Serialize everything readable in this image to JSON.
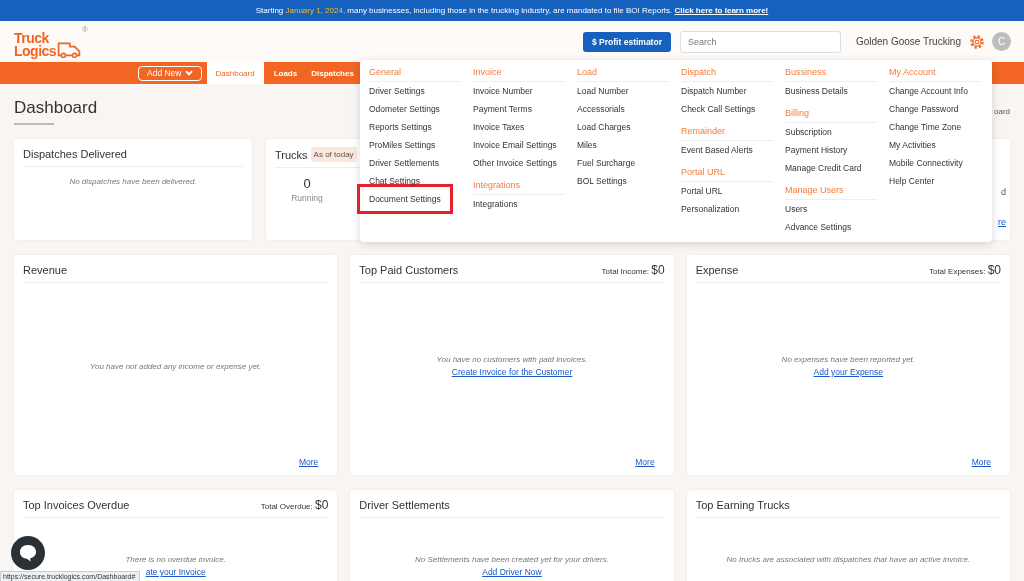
{
  "banner": {
    "lead": "Starting",
    "date": "January 1, 2024,",
    "rest": "many businesses, including those in the trucking industry, are mandated to file BOI Reports.",
    "link": "Click here to learn more!"
  },
  "header": {
    "logo": {
      "wordmark": "Truck Logics",
      "registered": "®"
    },
    "profit_button": "$ Profit estimator",
    "search": {
      "placeholder": "Search"
    },
    "company": "Golden Goose Trucking",
    "avatar": "C"
  },
  "nav": {
    "add_new": "Add New",
    "tabs": [
      {
        "label": "Dashboard",
        "selected": true
      },
      {
        "label": "Loads",
        "selected": false
      },
      {
        "label": "Dispatches",
        "selected": false
      }
    ]
  },
  "page": {
    "title": "Dashboard",
    "breadcrumb": "oard"
  },
  "card_rows": [
    {
      "cards": [
        {
          "kind": "message",
          "title": "Dispatches Delivered",
          "message": "No dispatches have been delivered."
        },
        {
          "kind": "stats",
          "title": "Trucks",
          "badge": "As of today",
          "stats": [
            {
              "value": "0",
              "label": "Running"
            }
          ]
        },
        {
          "kind": "covered",
          "text": "d",
          "link": "re"
        }
      ]
    },
    {
      "cards": [
        {
          "kind": "panel",
          "title": "Revenue",
          "message": "You have not added any income or expense yet.",
          "more": "More"
        },
        {
          "kind": "panel",
          "title": "Top Paid Customers",
          "total_label": "Total Income:",
          "total_value": "$0",
          "message": "You have no customers with paid invoices.",
          "link": "Create Invoice for the Customer",
          "more": "More"
        },
        {
          "kind": "panel",
          "title": "Expense",
          "total_label": "Total Expenses:",
          "total_value": "$0",
          "message": "No expenses have been reported yet.",
          "link": "Add your Expense",
          "more": "More"
        }
      ]
    },
    {
      "cards": [
        {
          "kind": "panel",
          "title": "Top Invoices Overdue",
          "total_label": "Total Overdue:",
          "total_value": "$0",
          "message": "There is no overdue invoice.",
          "link": "ate your Invoice"
        },
        {
          "kind": "panel",
          "title": "Driver Settlements",
          "message": "No Settlements have been created yet for your drivers.",
          "link": "Add Driver Now"
        },
        {
          "kind": "panel",
          "title": "Top Earning Trucks",
          "message": "No trucks are associated with dispatches that have an active invoice."
        }
      ]
    }
  ],
  "menu": {
    "columns": [
      {
        "sections": [
          {
            "heading": "General",
            "items": [
              {
                "label": "Driver Settings",
                "highlighted": false
              },
              {
                "label": "Odometer Settings",
                "highlighted": false
              },
              {
                "label": "Reports Settings",
                "highlighted": false
              },
              {
                "label": "ProMiles Settings",
                "highlighted": false
              },
              {
                "label": "Driver Settlements",
                "highlighted": false
              },
              {
                "label": "Chat Settings",
                "highlighted": false
              },
              {
                "label": "Document Settings",
                "highlighted": true
              }
            ]
          }
        ]
      },
      {
        "sections": [
          {
            "heading": "Invoice",
            "items": [
              {
                "label": "Invoice Number",
                "highlighted": false
              },
              {
                "label": "Payment Terms",
                "highlighted": false
              },
              {
                "label": "Invoice Taxes",
                "highlighted": false
              },
              {
                "label": "Invoice Email Settings",
                "highlighted": false
              },
              {
                "label": "Other Invoice Settings",
                "highlighted": false
              }
            ]
          },
          {
            "heading": "Integrations",
            "items": [
              {
                "label": "Integrations",
                "highlighted": false
              }
            ]
          }
        ]
      },
      {
        "sections": [
          {
            "heading": "Load",
            "items": [
              {
                "label": "Load Number",
                "highlighted": false
              },
              {
                "label": "Accessorials",
                "highlighted": false
              },
              {
                "label": "Load Charges",
                "highlighted": false
              },
              {
                "label": "Miles",
                "highlighted": false
              },
              {
                "label": "Fuel Surcharge",
                "highlighted": false
              },
              {
                "label": "BOL Settings",
                "highlighted": false
              }
            ]
          }
        ]
      },
      {
        "sections": [
          {
            "heading": "Dispatch",
            "items": [
              {
                "label": "Dispatch Number",
                "highlighted": false
              },
              {
                "label": "Check Call Settings",
                "highlighted": false
              }
            ]
          },
          {
            "heading": "Remainder",
            "items": [
              {
                "label": "Event Based Alerts",
                "highlighted": false
              }
            ]
          },
          {
            "heading": "Portal URL",
            "items": [
              {
                "label": "Portal URL",
                "highlighted": false
              },
              {
                "label": "Personalization",
                "highlighted": false
              }
            ]
          }
        ]
      },
      {
        "sections": [
          {
            "heading": "Bussiness",
            "items": [
              {
                "label": "Business Details",
                "highlighted": false
              }
            ]
          },
          {
            "heading": "Billing",
            "items": [
              {
                "label": "Subscription",
                "highlighted": false
              },
              {
                "label": "Payment History",
                "highlighted": false
              },
              {
                "label": "Manage Credit Card",
                "highlighted": false
              }
            ]
          },
          {
            "heading": "Manage Users",
            "items": [
              {
                "label": "Users",
                "highlighted": false
              },
              {
                "label": "Advance Settings",
                "highlighted": false
              }
            ]
          }
        ]
      },
      {
        "sections": [
          {
            "heading": "My Account",
            "items": [
              {
                "label": "Change Account Info",
                "highlighted": false
              },
              {
                "label": "Change Password",
                "highlighted": false
              },
              {
                "label": "Change Time Zone",
                "highlighted": false
              },
              {
                "label": "My Activities",
                "highlighted": false
              },
              {
                "label": "Mobile Connectivity",
                "highlighted": false
              },
              {
                "label": "Help Center",
                "highlighted": false
              }
            ]
          }
        ]
      }
    ]
  },
  "status_url": "https://secure.trucklogics.com/Dashboard#"
}
